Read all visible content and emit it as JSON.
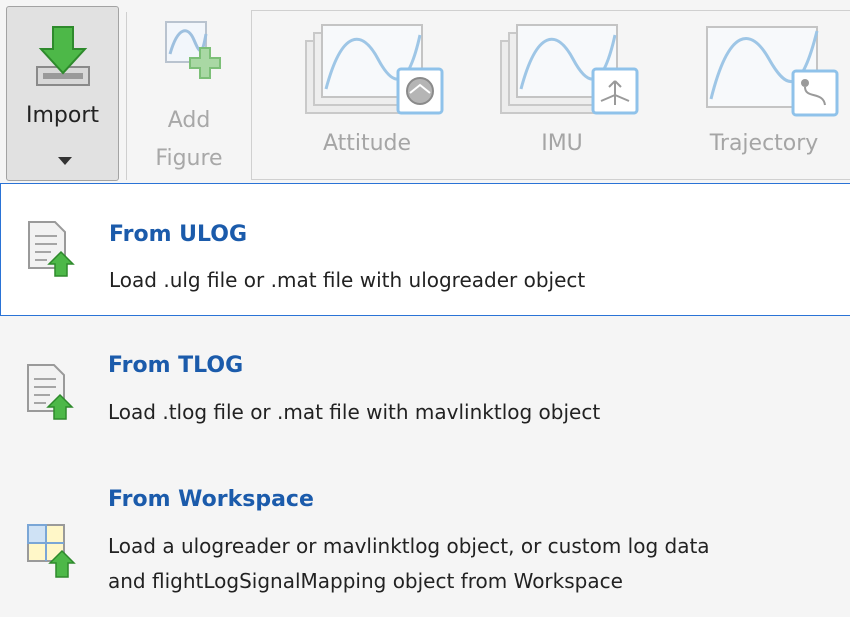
{
  "toolstrip": {
    "import_label": "Import",
    "add_figure_label_1": "Add",
    "add_figure_label_2": "Figure",
    "gallery": [
      {
        "label": "Attitude"
      },
      {
        "label": "IMU"
      },
      {
        "label": "Trajectory"
      }
    ]
  },
  "menu": {
    "items": [
      {
        "title": "From ULOG",
        "desc_1": "Load .ulg file or .mat file with ulogreader object",
        "desc_2": ""
      },
      {
        "title": "From TLOG",
        "desc_1": "Load .tlog file or .mat file with mavlinktlog object",
        "desc_2": ""
      },
      {
        "title": "From Workspace",
        "desc_1": "Load a ulogreader or mavlinktlog object, or custom log data",
        "desc_2": "and flightLogSignalMapping object from Workspace"
      }
    ]
  },
  "colors": {
    "accent": "#2a73d6",
    "title": "#1b5bab",
    "icon_green": "#3daa3b",
    "disabled": "#a8a8a8"
  }
}
